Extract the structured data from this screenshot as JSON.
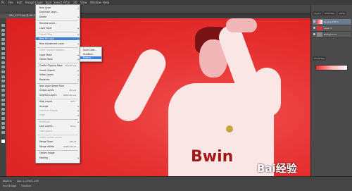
{
  "app": {
    "doc_tab_title": "IMG_9173.jpg @ 66.7% (RGB/8)",
    "menubar_items": [
      "Ps",
      "File",
      "Edit",
      "Image",
      "Layer",
      "Type",
      "Select",
      "Filter",
      "3D",
      "View",
      "Window",
      "Help"
    ]
  },
  "menu": {
    "items": [
      {
        "label": "New Layer",
        "shortcut": "",
        "arrow": true,
        "dis": false,
        "hl": false
      },
      {
        "label": "Duplicate Layer...",
        "shortcut": "",
        "arrow": false,
        "dis": false,
        "hl": false
      },
      {
        "label": "Delete",
        "shortcut": "",
        "arrow": true,
        "dis": false,
        "hl": false
      },
      {
        "label": "Rename Layer...",
        "shortcut": "",
        "arrow": false,
        "dis": false,
        "hl": false
      },
      {
        "label": "Layer Style",
        "shortcut": "",
        "arrow": true,
        "dis": false,
        "hl": false
      },
      {
        "label": "Smart Filter",
        "shortcut": "",
        "arrow": true,
        "dis": true,
        "hl": false
      },
      {
        "label": "New Fill Layer",
        "shortcut": "",
        "arrow": true,
        "dis": false,
        "hl": false
      },
      {
        "label": "New Adjustment Layer",
        "shortcut": "",
        "arrow": true,
        "dis": false,
        "hl": false
      },
      {
        "label": "Layer Content Options...",
        "shortcut": "",
        "arrow": false,
        "dis": true,
        "hl": false
      },
      {
        "label": "Layer Mask",
        "shortcut": "",
        "arrow": true,
        "dis": false,
        "hl": false
      },
      {
        "label": "Vector Mask",
        "shortcut": "",
        "arrow": true,
        "dis": false,
        "hl": false
      },
      {
        "label": "Create Clipping Mask",
        "shortcut": "Alt+Ctrl+G",
        "arrow": false,
        "dis": false,
        "hl": false
      },
      {
        "label": "Smart Objects",
        "shortcut": "",
        "arrow": true,
        "dis": false,
        "hl": false
      },
      {
        "label": "Video Layers",
        "shortcut": "",
        "arrow": true,
        "dis": false,
        "hl": false
      },
      {
        "label": "Rasterize",
        "shortcut": "",
        "arrow": true,
        "dis": false,
        "hl": false
      },
      {
        "label": "New Layer Based Slice",
        "shortcut": "",
        "arrow": false,
        "dis": false,
        "hl": false
      },
      {
        "label": "Group Layers",
        "shortcut": "Ctrl+G",
        "arrow": false,
        "dis": false,
        "hl": false
      },
      {
        "label": "Ungroup Layers",
        "shortcut": "Shift+Ctrl+G",
        "arrow": false,
        "dis": false,
        "hl": false
      },
      {
        "label": "Hide Layers",
        "shortcut": "Ctrl+,",
        "arrow": false,
        "dis": false,
        "hl": false
      },
      {
        "label": "Arrange",
        "shortcut": "",
        "arrow": true,
        "dis": false,
        "hl": false
      },
      {
        "label": "Combine Shapes",
        "shortcut": "",
        "arrow": true,
        "dis": true,
        "hl": false
      },
      {
        "label": "Align",
        "shortcut": "",
        "arrow": true,
        "dis": true,
        "hl": false
      },
      {
        "label": "Distribute",
        "shortcut": "",
        "arrow": true,
        "dis": true,
        "hl": false
      },
      {
        "label": "Lock Layers...",
        "shortcut": "Ctrl+/",
        "arrow": false,
        "dis": false,
        "hl": false
      },
      {
        "label": "Link Layers",
        "shortcut": "",
        "arrow": false,
        "dis": true,
        "hl": false
      },
      {
        "label": "Select Linked Layers",
        "shortcut": "",
        "arrow": false,
        "dis": true,
        "hl": false
      },
      {
        "label": "Merge Down",
        "shortcut": "Ctrl+E",
        "arrow": false,
        "dis": false,
        "hl": false
      },
      {
        "label": "Merge Visible",
        "shortcut": "Shift+Ctrl+E",
        "arrow": false,
        "dis": false,
        "hl": false
      },
      {
        "label": "Flatten Image",
        "shortcut": "",
        "arrow": false,
        "dis": false,
        "hl": false
      },
      {
        "label": "Matting",
        "shortcut": "",
        "arrow": true,
        "dis": false,
        "hl": false
      }
    ],
    "highlighted_label": "New Fill Layer"
  },
  "submenu": {
    "items": [
      "Solid Color...",
      "Gradient...",
      "Pattern..."
    ],
    "highlighted": "Pattern..."
  },
  "panels": {
    "tabs": [
      "Layers",
      "Channels",
      "Paths"
    ],
    "props_tab": "Properties",
    "layers": [
      {
        "name": "Gradient Fill 1",
        "selected": true
      },
      {
        "name": "Layer 1",
        "selected": false
      },
      {
        "name": "Background",
        "selected": false
      }
    ]
  },
  "status": {
    "zoom": "66.67%",
    "doc_info": "Doc: 1.17M/1.17M",
    "tabs": [
      "Mini Bridge",
      "Timeline"
    ]
  },
  "watermark": {
    "brand": "Bai经验",
    "sub": "jingyan.baidu.com"
  },
  "photo": {
    "shirt_text": "Bwin"
  },
  "colors": {
    "canvas_red": "#e73232",
    "menu_bg": "#f2f2f2",
    "highlight": "#3d7fd9"
  }
}
